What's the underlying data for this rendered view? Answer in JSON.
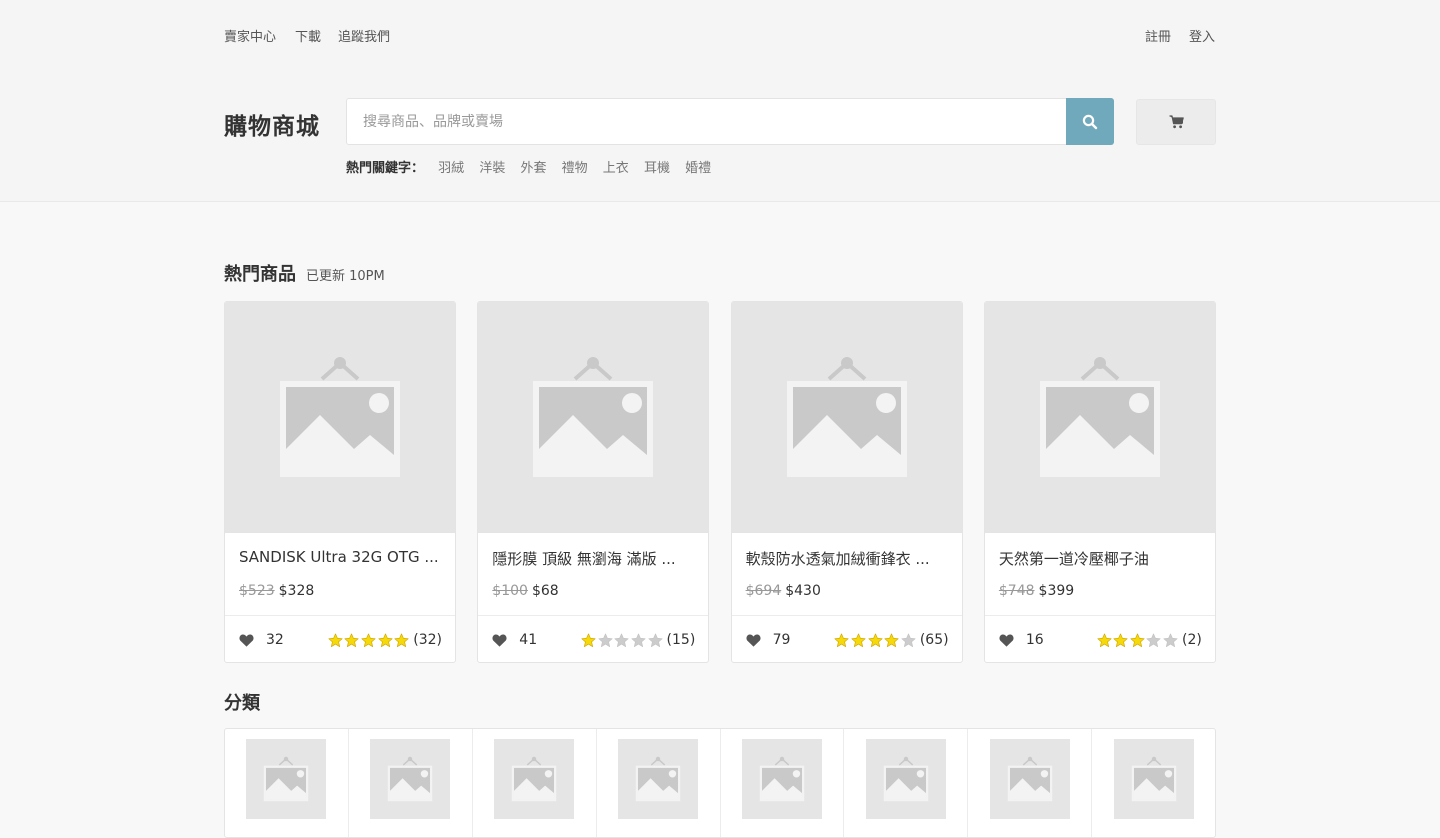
{
  "topbar": {
    "left_links": [
      "賣家中心",
      "下載",
      "追蹤我們"
    ],
    "right_links": [
      "註冊",
      "登入"
    ]
  },
  "brand": "購物商城",
  "search": {
    "placeholder": "搜尋商品、品牌或賣場",
    "value": "",
    "button_icon": "search-icon"
  },
  "cart": {
    "icon": "cart-icon"
  },
  "hot_keywords": {
    "label": "熱門關鍵字：",
    "items": [
      "羽絨",
      "洋裝",
      "外套",
      "禮物",
      "上衣",
      "耳機",
      "婚禮"
    ]
  },
  "hot_section": {
    "title": "熱門商品",
    "subtitle": "已更新 10PM"
  },
  "products": [
    {
      "name": "SANDISK Ultra 32G OTG ...",
      "old_price": "$523",
      "price": "$328",
      "likes": "32",
      "rating": 5,
      "reviews": "(32)"
    },
    {
      "name": "隱形膜 頂級 無瀏海 滿版 ...",
      "old_price": "$100",
      "price": "$68",
      "likes": "41",
      "rating": 1,
      "reviews": "(15)"
    },
    {
      "name": "軟殼防水透氣加絨衝鋒衣 ...",
      "old_price": "$694",
      "price": "$430",
      "likes": "79",
      "rating": 4,
      "reviews": "(65)"
    },
    {
      "name": "天然第一道冷壓椰子油",
      "old_price": "$748",
      "price": "$399",
      "likes": "16",
      "rating": 3,
      "reviews": "(2)"
    }
  ],
  "category_section": {
    "title": "分類",
    "count": 8
  },
  "colors": {
    "accent": "#6fa9bb",
    "star_on": "#f5d90a",
    "star_off": "#cccccc"
  }
}
